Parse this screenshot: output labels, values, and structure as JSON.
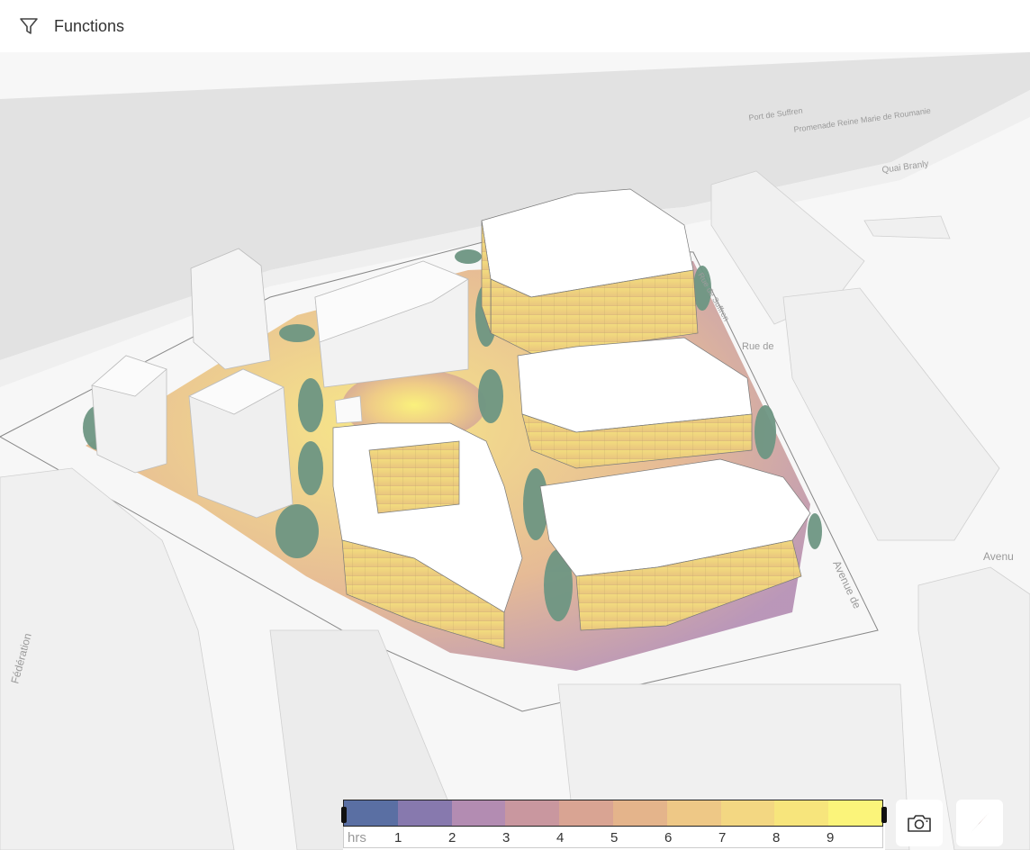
{
  "topbar": {
    "functions_label": "Functions",
    "functions_icon": "filter-icon"
  },
  "map": {
    "street_labels": [
      "Port de Suffren",
      "Promenade Reine Marie de Roumanie",
      "Quai Branly",
      "Rue de",
      "Avenue de",
      "Avenu",
      "Fédération",
      "Rue de Suffren"
    ],
    "colors": {
      "water": "#e2e2e2",
      "ground": "#f7f7f7",
      "building": "#f1f1f1",
      "tree": "#6e9683"
    }
  },
  "legend": {
    "unit": "hrs",
    "ticks": [
      "1",
      "2",
      "3",
      "4",
      "5",
      "6",
      "7",
      "8",
      "9"
    ],
    "colors": [
      "#5a6fa3",
      "#8779ae",
      "#b38cb2",
      "#c9979f",
      "#d9a493",
      "#e4b48b",
      "#eec886",
      "#f3d782",
      "#f7e57c",
      "#fbf47a"
    ]
  },
  "controls": {
    "camera_icon": "camera-icon",
    "compass_icon": "compass-icon"
  }
}
